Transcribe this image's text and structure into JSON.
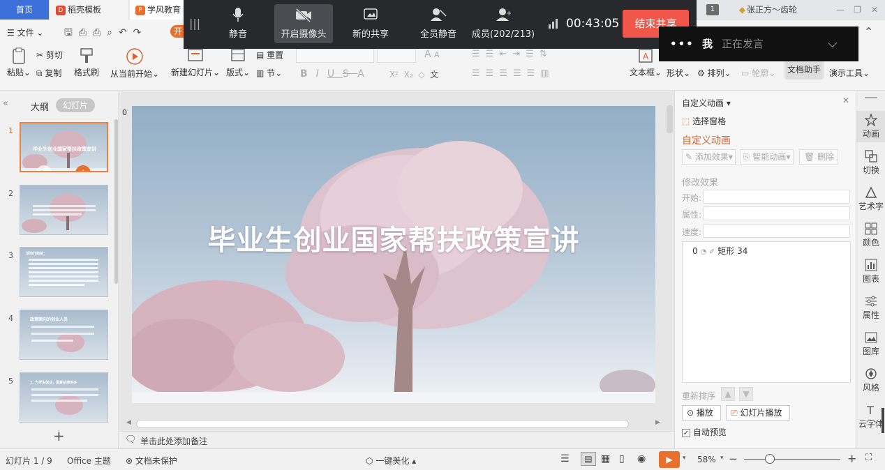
{
  "tabs": {
    "home": "首页",
    "template": "稻壳模板",
    "doc": "学风教育"
  },
  "user": {
    "badge": "1",
    "name": "张正方～齿轮"
  },
  "meeting": {
    "mute": "静音",
    "camera": "开启摄像头",
    "new_share": "新的共享",
    "mute_all": "全员静音",
    "members": "成员(202/213)",
    "timer": "00:43:05",
    "end_share": "结束共享",
    "speaker_me": "我",
    "speaker_status": "正在发言"
  },
  "menu": {
    "file": "文件",
    "start_badge": "开"
  },
  "ribbon": {
    "paste": "粘贴",
    "cut": "剪切",
    "copy": "复制",
    "format_painter": "格式刷",
    "from_current": "从当前开始",
    "new_slide": "新建幻灯片",
    "layout": "版式",
    "reset": "重置",
    "section": "节",
    "text_box": "文本框",
    "shape": "形状",
    "arrange": "排列",
    "outline": "轮廓",
    "doc_assistant": "文档助手",
    "presenter_tools": "演示工具",
    "font_btns": [
      "B",
      "I",
      "U",
      "S",
      "A",
      "X²",
      "X₂"
    ],
    "aa_big": "A",
    "aa_small": "A",
    "wen": "文"
  },
  "left_panel": {
    "outline_tab": "大纲",
    "slides_tab": "幻灯片",
    "thumbs": [
      {
        "num": "1",
        "title": "毕业生创业国家帮扶政策宣讲"
      },
      {
        "num": "2"
      },
      {
        "num": "3",
        "title": "活动开始前："
      },
      {
        "num": "4",
        "title": "政策面向的创业人员"
      },
      {
        "num": "5",
        "title": "1. 大学生创业，国家扶持多多"
      }
    ]
  },
  "slide": {
    "marker": "0",
    "title": "毕业生创业国家帮扶政策宣讲"
  },
  "notes_placeholder": "单击此处添加备注",
  "anim_panel": {
    "header": "自定义动画",
    "select_pane": "选择窗格",
    "title": "自定义动画",
    "add_effect": "添加效果",
    "smart_anim": "智能动画",
    "delete": "删除",
    "modify": "修改效果",
    "start_label": "开始:",
    "prop_label": "属性:",
    "speed_label": "速度:",
    "list_index": "0",
    "list_item": "矩形 34",
    "reorder": "重新排序",
    "play": "播放",
    "slideshow": "幻灯片播放",
    "auto_preview": "自动预览"
  },
  "right_rail": [
    "动画",
    "切换",
    "艺术字",
    "颜色",
    "图表",
    "属性",
    "图库",
    "风格",
    "云字体"
  ],
  "status": {
    "slide_count": "幻灯片 1 / 9",
    "theme": "Office 主题",
    "protect": "文档未保护",
    "beautify": "一键美化",
    "zoom": "58%"
  },
  "colors": {
    "accent_blue": "#3c6fd8",
    "end_red": "#f0574a",
    "orange": "#d9622b"
  }
}
